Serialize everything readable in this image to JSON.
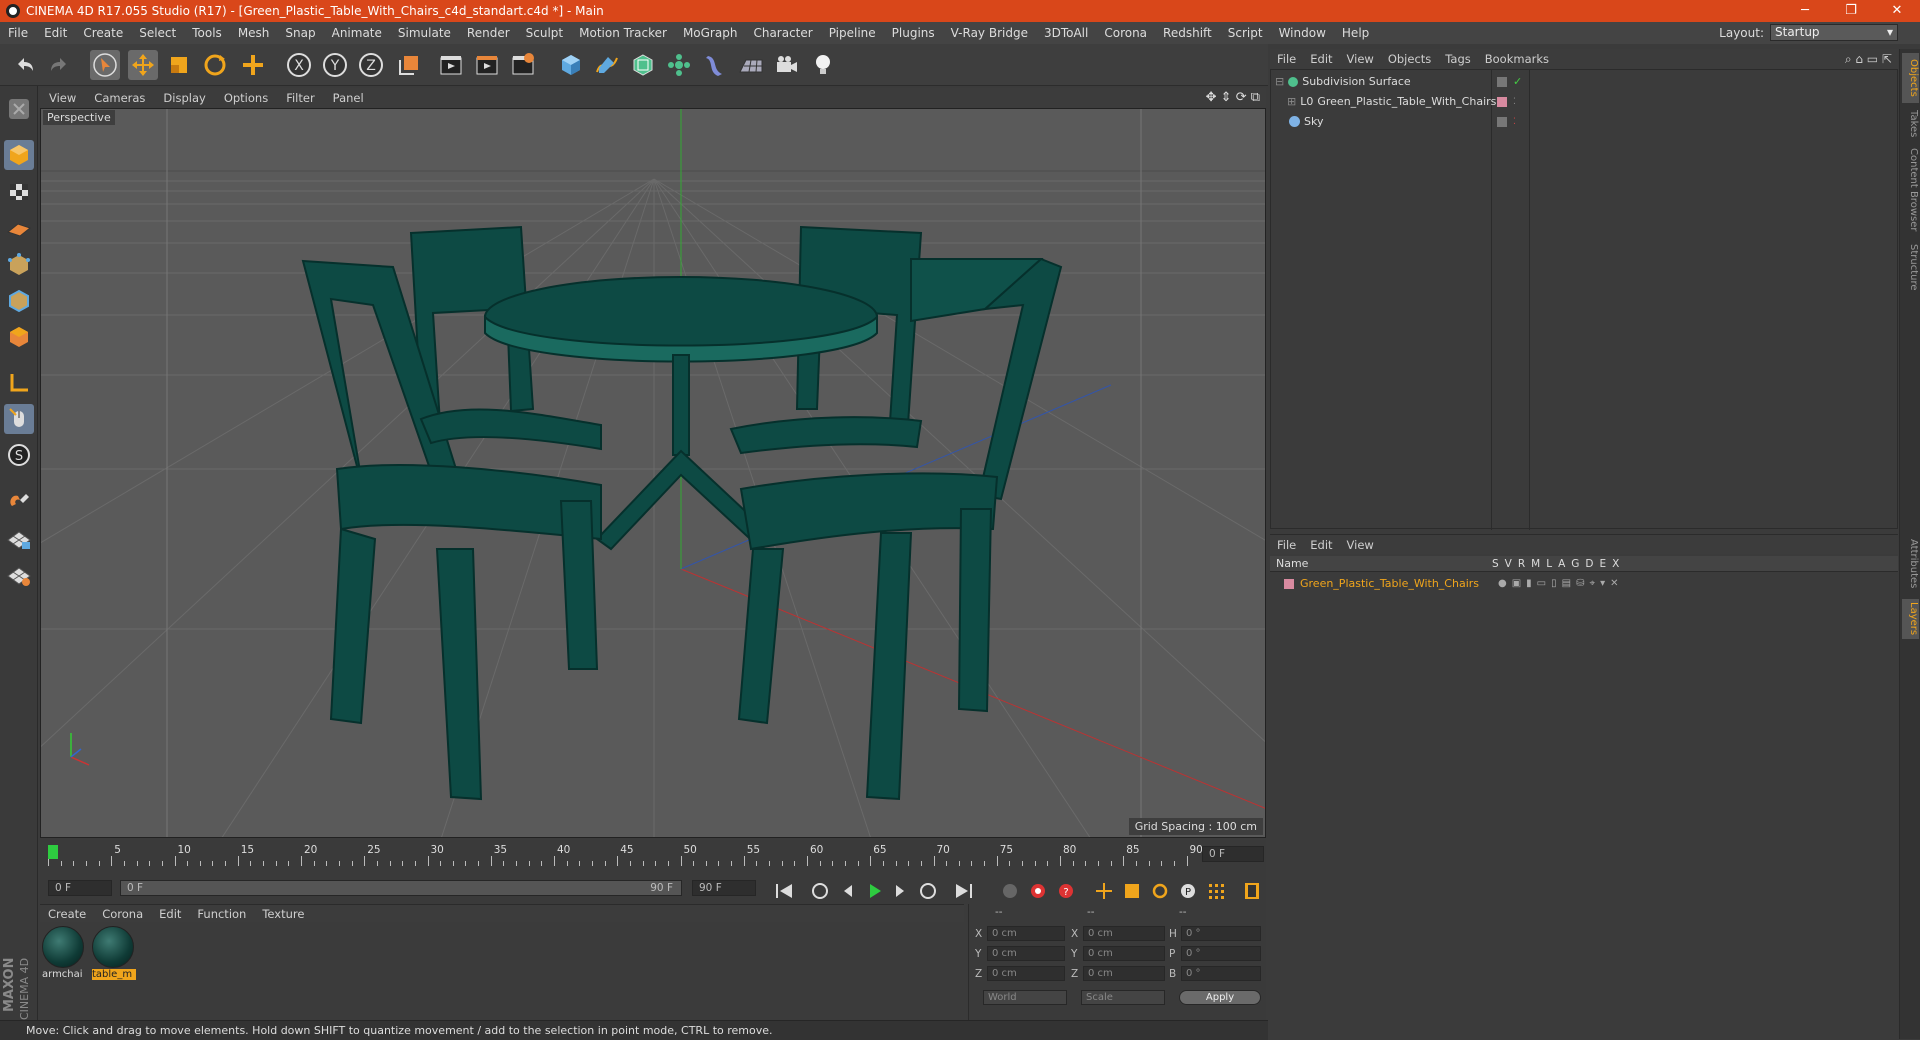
{
  "window": {
    "title": "CINEMA 4D R17.055 Studio (R17) - [Green_Plastic_Table_With_Chairs_c4d_standart.c4d *] - Main"
  },
  "menubar": {
    "items": [
      "File",
      "Edit",
      "Create",
      "Select",
      "Tools",
      "Mesh",
      "Snap",
      "Animate",
      "Simulate",
      "Render",
      "Sculpt",
      "Motion Tracker",
      "MoGraph",
      "Character",
      "Pipeline",
      "Plugins",
      "V-Ray Bridge",
      "3DToAll",
      "Corona",
      "Redshift",
      "Script",
      "Window",
      "Help"
    ],
    "layout_label": "Layout:",
    "layout_value": "Startup"
  },
  "toolbar": {
    "icons": [
      "undo-icon",
      "redo-icon",
      "select-arrow-icon",
      "move-icon",
      "scale-icon",
      "rotate-icon",
      "move-plus-icon",
      "x-axis-icon",
      "y-axis-icon",
      "z-axis-icon",
      "coordinate-system-icon",
      "render-view-icon",
      "render-picture-viewer-icon",
      "edit-render-settings-icon",
      "cube-icon",
      "pen-spline-icon",
      "nurbs-icon",
      "array-icon",
      "deformer-icon",
      "floor-grid-icon",
      "camera-icon",
      "light-icon"
    ]
  },
  "viewport": {
    "menu": [
      "View",
      "Cameras",
      "Display",
      "Options",
      "Filter",
      "Panel"
    ],
    "label": "Perspective",
    "grid_spacing": "Grid Spacing : 100 cm",
    "model_color": "#0d4a44"
  },
  "timeline": {
    "ticks": [
      "0",
      "5",
      "10",
      "15",
      "20",
      "25",
      "30",
      "35",
      "40",
      "45",
      "50",
      "55",
      "60",
      "65",
      "70",
      "75",
      "80",
      "85",
      "90"
    ],
    "current_frame": "0 F",
    "start_field": "0 F",
    "range_start": "0 F",
    "range_end": "90 F",
    "end_field": "90 F"
  },
  "material_manager": {
    "menu": [
      "Create",
      "Corona",
      "Edit",
      "Function",
      "Texture"
    ],
    "materials": [
      {
        "label": "armchai",
        "selected": false
      },
      {
        "label": "table_m",
        "selected": true
      }
    ]
  },
  "coordinates": {
    "header": [
      "--",
      "--",
      "--"
    ],
    "rows": [
      {
        "l1": "X",
        "v1": "0 cm",
        "l2": "X",
        "v2": "0 cm",
        "l3": "H",
        "v3": "0 °"
      },
      {
        "l1": "Y",
        "v1": "0 cm",
        "l2": "Y",
        "v2": "0 cm",
        "l3": "P",
        "v3": "0 °"
      },
      {
        "l1": "Z",
        "v1": "0 cm",
        "l2": "Z",
        "v2": "0 cm",
        "l3": "B",
        "v3": "0 °"
      }
    ],
    "mode1": "World",
    "mode2": "Scale",
    "apply_label": "Apply"
  },
  "object_manager": {
    "menu": [
      "File",
      "Edit",
      "View",
      "Objects",
      "Tags",
      "Bookmarks"
    ],
    "objects": [
      {
        "name": "Subdivision Surface",
        "indent": 0
      },
      {
        "name": "Green_Plastic_Table_With_Chairs",
        "indent": 1
      },
      {
        "name": "Sky",
        "indent": 0
      }
    ]
  },
  "layer_manager": {
    "menu": [
      "File",
      "Edit",
      "View"
    ],
    "header_name": "Name",
    "header_cols": [
      "S",
      "V",
      "R",
      "M",
      "L",
      "A",
      "G",
      "D",
      "E",
      "X"
    ],
    "layers": [
      {
        "name": "Green_Plastic_Table_With_Chairs",
        "color": "#d88aa0"
      }
    ]
  },
  "side_tabs": [
    "Objects",
    "Takes",
    "Content Browser",
    "Structure",
    "Attributes",
    "Layers"
  ],
  "status": {
    "text": "Move: Click and drag to move elements. Hold down SHIFT to quantize movement / add to the selection in point mode, CTRL to remove."
  },
  "brand": {
    "maxon": "MAXON",
    "cinema": "CINEMA 4D"
  },
  "colors": {
    "title_bar": "#d9471a",
    "accent_orange": "#f0a51c",
    "selected_blue": "#6a7d96"
  }
}
